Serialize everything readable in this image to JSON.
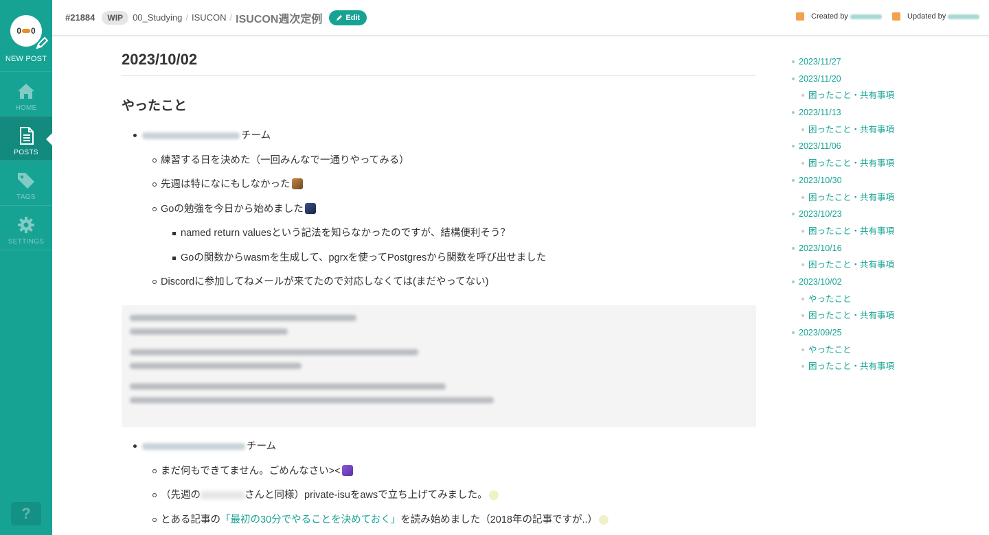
{
  "sidebar": {
    "avatar_text_left": "0",
    "avatar_text_right": "0",
    "new_post": "NEW POST",
    "items": [
      {
        "label": "HOME",
        "icon": "home-icon",
        "active": false
      },
      {
        "label": "POSTS",
        "icon": "document-icon",
        "active": true
      },
      {
        "label": "TAGS",
        "icon": "tag-icon",
        "active": false
      },
      {
        "label": "SETTINGS",
        "icon": "gear-icon",
        "active": false
      }
    ],
    "help": "?"
  },
  "header": {
    "post_id": "#21884",
    "wip": "WIP",
    "breadcrumb": [
      "00_Studying",
      "ISUCON"
    ],
    "title": "ISUCON週次定例",
    "edit": "Edit",
    "created_by": "Created by",
    "updated_by": "Updated by"
  },
  "content": {
    "h1": "2023/10/02",
    "h2": "やったこと",
    "team_suffix": "チーム",
    "items": [
      "練習する日を決めた（一回みんなで一通りやってみる）",
      "先週は特になにもしなかった",
      "Goの勉強を今日から始めました",
      "named return valuesという記法を知らなかったのですが、結構便利そう？",
      "Goの関数からwasmを生成して、pgrxを使ってPostgresから関数を呼び出せました",
      "Discordに参加してねメールが来てたので対応しなくては(まだやってない)"
    ],
    "items2": [
      "まだ何もできてません。ごめんなさい><",
      "（先週の",
      "さんと同様）private-isuをawsで立ち上げてみました。",
      "とある記事の",
      "「最初の30分でやることを決めておく」",
      "を読み始めました（2018年の記事ですが..）"
    ]
  },
  "toc": [
    {
      "label": "2023/11/27",
      "level": 1
    },
    {
      "label": "2023/11/20",
      "level": 1
    },
    {
      "label": "困ったこと・共有事項",
      "level": 2
    },
    {
      "label": "2023/11/13",
      "level": 1
    },
    {
      "label": "困ったこと・共有事項",
      "level": 2
    },
    {
      "label": "2023/11/06",
      "level": 1
    },
    {
      "label": "困ったこと・共有事項",
      "level": 2
    },
    {
      "label": "2023/10/30",
      "level": 1
    },
    {
      "label": "困ったこと・共有事項",
      "level": 2
    },
    {
      "label": "2023/10/23",
      "level": 1
    },
    {
      "label": "困ったこと・共有事項",
      "level": 2
    },
    {
      "label": "2023/10/16",
      "level": 1
    },
    {
      "label": "困ったこと・共有事項",
      "level": 2
    },
    {
      "label": "2023/10/02",
      "level": 1
    },
    {
      "label": "やったこと",
      "level": 2
    },
    {
      "label": "困ったこと・共有事項",
      "level": 2
    },
    {
      "label": "2023/09/25",
      "level": 1
    },
    {
      "label": "やったこと",
      "level": 2
    },
    {
      "label": "困ったこと・共有事項",
      "level": 2
    }
  ],
  "colors": {
    "accent": "#17a394",
    "sidebar_active": "#128b7e"
  }
}
